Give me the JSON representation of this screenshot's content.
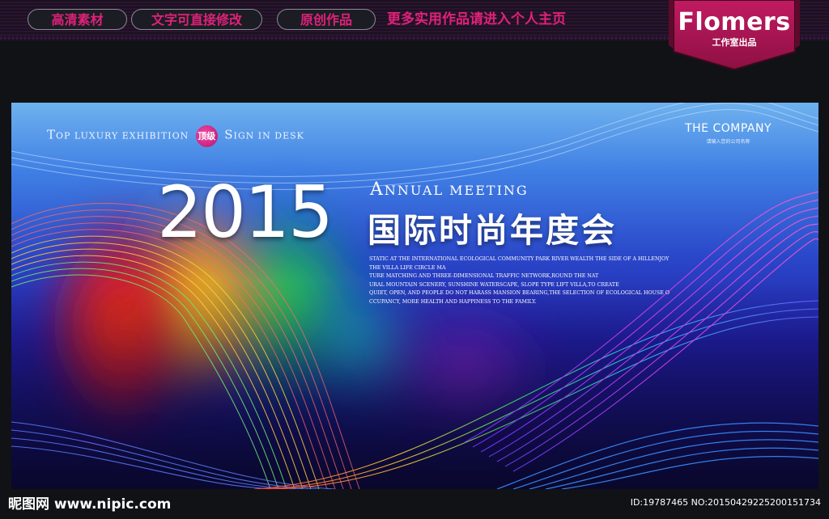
{
  "top_bar": {
    "pills": [
      "高清素材",
      "文字可直接修改",
      "原创作品"
    ],
    "promo": "更多实用作品请进入个人主页",
    "brand_name": "Flomers",
    "brand_sub": "工作室出品",
    "accent_color": "#e0217a",
    "brand_color": "#a5154f"
  },
  "board": {
    "top_left": {
      "t_big": "T",
      "t_rest": "OP LUXURY EXHIBITION",
      "badge": "顶级",
      "s_big": "S",
      "s_rest": "IGN IN DESK"
    },
    "company_name": "THE COMPANY",
    "company_hint": "请输入您的公司名称",
    "year": "2015",
    "meeting_big": "A",
    "meeting_rest": "NNUAL MEETING",
    "title_cn": "国际时尚年度会",
    "paragraph": [
      "STATIC AT THE INTERNATIONAL ECOLOGICAL COMMUNITY PARK RIVER WEALTH THE SIDE OF A HILLENJOY",
      "THE VILLA LIFE CIRCLE MA",
      "TURE MATCHING AND THREE-DIMENSIONAL TRAFFIC NETWORK,ROUND THE NAT",
      "URAL MOUNTAIN SCENERY, SUNSHINE WATERSCAPE, SLOPE TYPE LIFT VILLA,TO CREATE",
      "QUIET, OPEN, AND PEOPLE DO NOT HARASS MANSION BEARING,THE SELECTION OF ECOLOGICAL HOUSE O",
      "CCUPANCY, MORE HEALTH AND HAPPINESS TO THE FAMILY."
    ]
  },
  "watermark": {
    "site": "昵图网 www.nipic.com",
    "id_text": "ID:19787465 NO:20150429225200151734"
  }
}
